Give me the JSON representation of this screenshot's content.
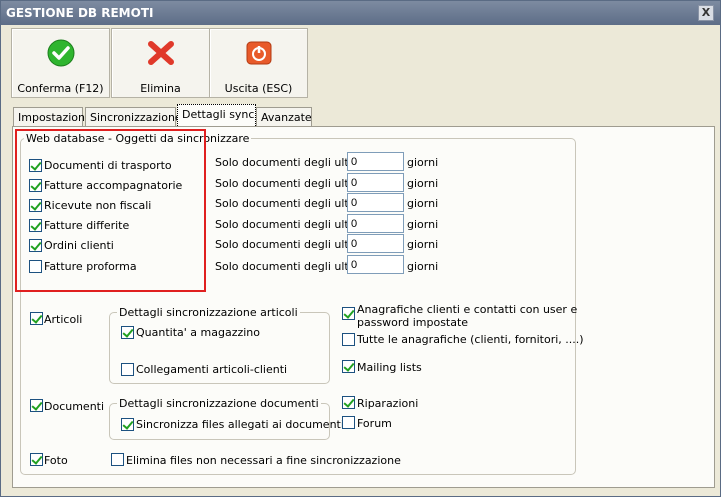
{
  "window": {
    "title": "GESTIONE DB REMOTI",
    "close_glyph": "X"
  },
  "toolbar": {
    "confirm_label": "Conferma (F12)",
    "delete_label": "Elimina",
    "exit_label": "Uscita (ESC)"
  },
  "tabs": [
    "Impostazioni",
    "Sincronizzazione",
    "Dettagli sync",
    "Avanzate"
  ],
  "active_tab": "Dettagli sync",
  "web_group": {
    "label": "Web database - Oggetti da sincronizzare",
    "rows": [
      {
        "name": "Documenti di trasporto",
        "checked": true,
        "prefix": "Solo documenti degli ultimi",
        "days": "0",
        "suffix": "giorni"
      },
      {
        "name": "Fatture accompagnatorie",
        "checked": true,
        "prefix": "Solo documenti degli ultimi",
        "days": "0",
        "suffix": "giorni"
      },
      {
        "name": "Ricevute non fiscali",
        "checked": true,
        "prefix": "Solo documenti degli ultimi",
        "days": "0",
        "suffix": "giorni"
      },
      {
        "name": "Fatture differite",
        "checked": true,
        "prefix": "Solo documenti degli ultimi",
        "days": "0",
        "suffix": "giorni"
      },
      {
        "name": "Ordini clienti",
        "checked": true,
        "prefix": "Solo documenti degli ultimi",
        "days": "0",
        "suffix": "giorni"
      },
      {
        "name": "Fatture proforma",
        "checked": false,
        "prefix": "Solo documenti degli ultimi",
        "days": "0",
        "suffix": "giorni"
      }
    ],
    "articoli": "Articoli",
    "articoli_group": {
      "label": "Dettagli sincronizzazione articoli",
      "quantita": "Quantita' a magazzino",
      "collegamenti": "Collegamenti articoli-clienti"
    },
    "anagrafiche": "Anagrafiche clienti e contatti con user e password impostate",
    "anagrafiche_line1": "Anagrafiche clienti e contatti con user e",
    "anagrafiche_line2": "password impostate",
    "tutte": "Tutte le anagrafiche (clienti, fornitori, ....)",
    "mailing": "Mailing lists",
    "documenti": "Documenti",
    "documenti_group": {
      "label": "Dettagli sincronizzazione documenti",
      "sincronizza": "Sincronizza files allegati ai documenti"
    },
    "riparazioni": "Riparazioni",
    "forum": "Forum",
    "foto": "Foto",
    "elimina_files": "Elimina files non necessari a fine sincronizzazione"
  },
  "colors": {
    "highlight": "#e02020",
    "check": "#21a121",
    "titlebar": "#6d7b93"
  }
}
